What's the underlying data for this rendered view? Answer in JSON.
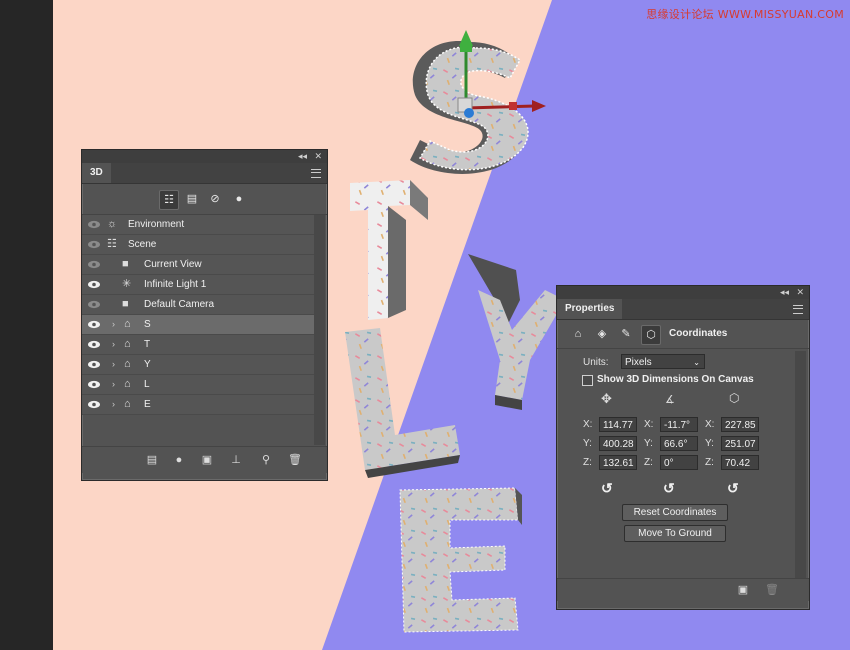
{
  "watermark": "思缘设计论坛 WWW.MISSYUAN.COM",
  "colors": {
    "peach": "#fcd6c6",
    "purple": "#9089f0",
    "panel": "#535353"
  },
  "panel3d": {
    "tab": "3D",
    "tools": [
      "scene-filter-icon",
      "mesh-filter-icon",
      "material-filter-icon",
      "light-filter-icon"
    ],
    "rows": [
      {
        "label": "Environment",
        "icon": "environment-icon",
        "eye": "dim",
        "arrow": false,
        "indent": false
      },
      {
        "label": "Scene",
        "icon": "scene-icon",
        "eye": "dim",
        "arrow": false,
        "indent": false
      },
      {
        "label": "Current View",
        "icon": "camera-icon",
        "eye": "dim",
        "arrow": false,
        "indent": true
      },
      {
        "label": "Infinite Light 1",
        "icon": "light-icon",
        "eye": "on",
        "arrow": false,
        "indent": true
      },
      {
        "label": "Default Camera",
        "icon": "camera-icon",
        "eye": "dim",
        "arrow": false,
        "indent": true
      },
      {
        "label": "S",
        "icon": "mesh-icon",
        "eye": "on",
        "arrow": true,
        "indent": false,
        "selected": true
      },
      {
        "label": "T",
        "icon": "mesh-icon",
        "eye": "on",
        "arrow": true,
        "indent": false
      },
      {
        "label": "Y",
        "icon": "mesh-icon",
        "eye": "on",
        "arrow": true,
        "indent": false
      },
      {
        "label": "L",
        "icon": "mesh-icon",
        "eye": "on",
        "arrow": true,
        "indent": false
      },
      {
        "label": "E",
        "icon": "mesh-icon",
        "eye": "on",
        "arrow": true,
        "indent": false
      }
    ]
  },
  "properties": {
    "tab": "Properties",
    "section": "Coordinates",
    "units_label": "Units:",
    "units_value": "Pixels",
    "show_dims_label": "Show 3D Dimensions On Canvas",
    "position": {
      "x": "114.77",
      "y": "400.28",
      "z": "132.61"
    },
    "rotation": {
      "x": "-11.7°",
      "y": "66.6°",
      "z": "0°"
    },
    "scale": {
      "x": "227.85",
      "y": "251.07",
      "z": "70.42"
    },
    "axis_labels": {
      "x": "X:",
      "y": "Y:",
      "z": "Z:"
    },
    "reset_label": "Reset Coordinates",
    "ground_label": "Move To Ground"
  },
  "letters": [
    "S",
    "T",
    "Y",
    "L",
    "E"
  ]
}
